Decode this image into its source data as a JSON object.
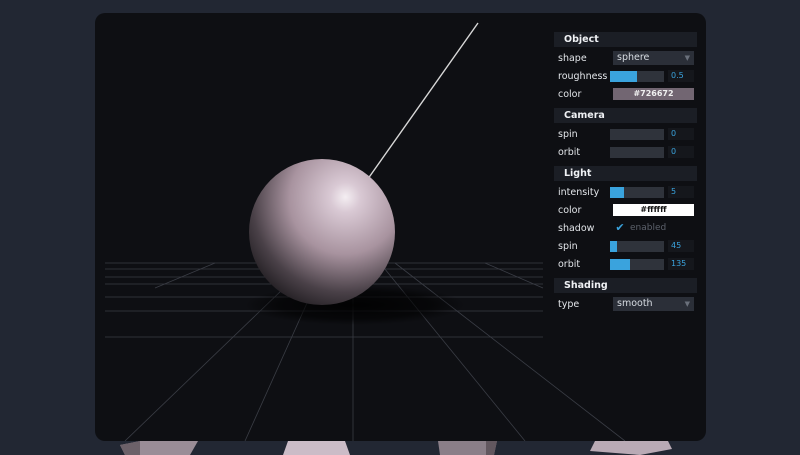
{
  "panel": {
    "object": {
      "title": "Object",
      "shape": {
        "label": "shape",
        "value": "sphere"
      },
      "roughness": {
        "label": "roughness",
        "value": "0.5",
        "fraction": 0.5
      },
      "color": {
        "label": "color",
        "value": "#726672",
        "swatch": "#726672",
        "text_color": "#f0f0f0"
      }
    },
    "camera": {
      "title": "Camera",
      "spin": {
        "label": "spin",
        "value": "0",
        "fraction": 0
      },
      "orbit": {
        "label": "orbit",
        "value": "0",
        "fraction": 0
      }
    },
    "light": {
      "title": "Light",
      "intensity": {
        "label": "intensity",
        "value": "5",
        "fraction": 0.25
      },
      "color": {
        "label": "color",
        "value": "#ffffff",
        "swatch": "#ffffff",
        "text_color": "#111111"
      },
      "shadow": {
        "label": "shadow",
        "checked": true,
        "check_label": "enabled"
      },
      "spin": {
        "label": "spin",
        "value": "45",
        "fraction": 0.125
      },
      "orbit": {
        "label": "orbit",
        "value": "135",
        "fraction": 0.375
      }
    },
    "shading": {
      "title": "Shading",
      "type": {
        "label": "type",
        "value": "smooth"
      }
    }
  },
  "colors": {
    "accent": "#3aa3dd",
    "sphere": "#c9b5c3",
    "background": "#222733",
    "viewport": "#0e0f13"
  }
}
